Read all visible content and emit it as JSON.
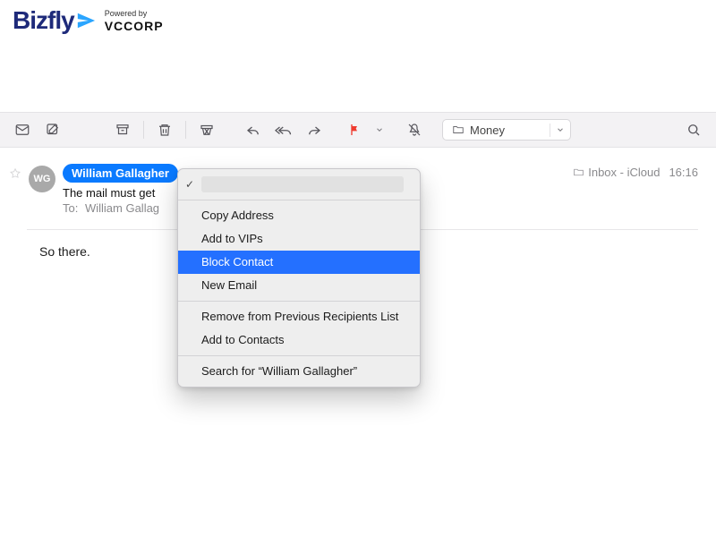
{
  "logo": {
    "brand": "Bizfly",
    "powered_label": "Powered by",
    "company": "VCCORP"
  },
  "toolbar": {
    "folder_selected": "Money"
  },
  "message": {
    "avatar_initials": "WG",
    "sender_name": "William Gallagher",
    "subject": "The mail must get",
    "to_label": "To:",
    "to_name": "William Gallag",
    "mailbox": "Inbox - iCloud",
    "time": "16:16",
    "body": "So there."
  },
  "context_menu": {
    "items": [
      {
        "label": "",
        "checked": true,
        "redacted": true
      },
      "---",
      {
        "label": "Copy Address"
      },
      {
        "label": "Add to VIPs"
      },
      {
        "label": "Block Contact",
        "selected": true
      },
      {
        "label": "New Email"
      },
      "---",
      {
        "label": "Remove from Previous Recipients List"
      },
      {
        "label": "Add to Contacts"
      },
      "---",
      {
        "label": "Search for “William Gallagher”"
      }
    ]
  }
}
